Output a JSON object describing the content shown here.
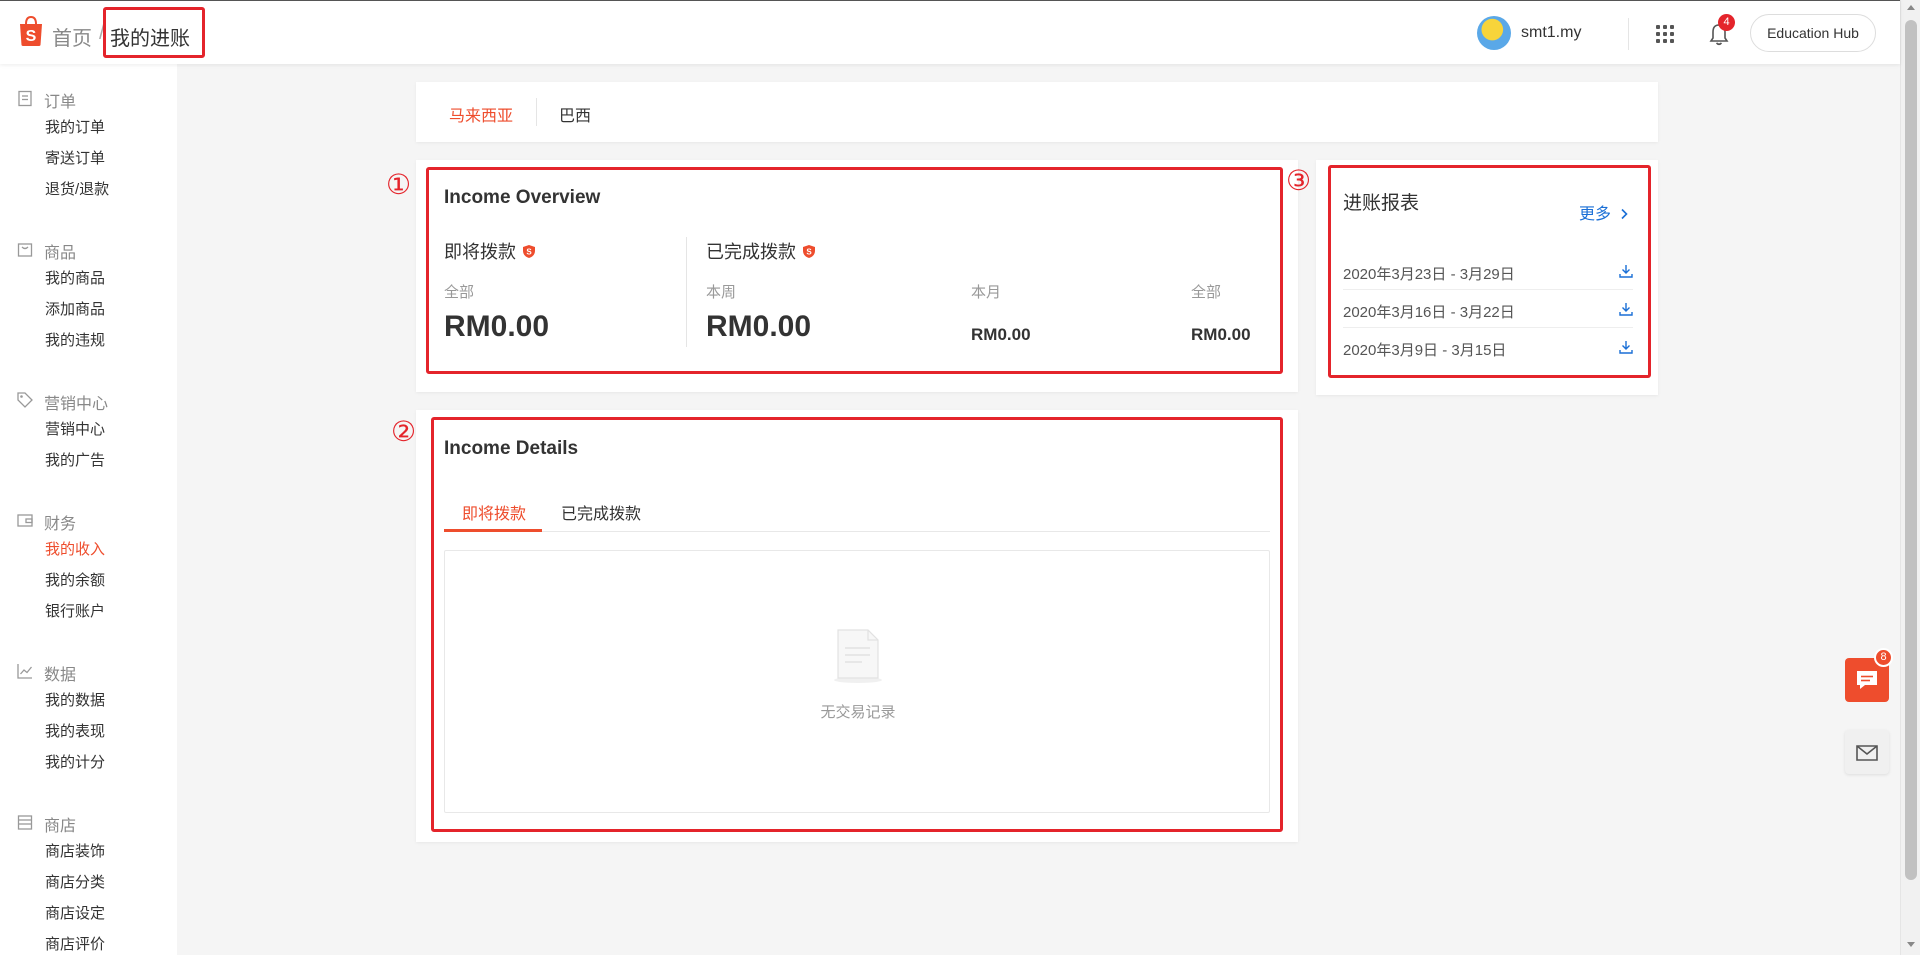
{
  "header": {
    "breadcrumb_home": "首页",
    "breadcrumb_sep": "/",
    "breadcrumb_current": "我的进账",
    "username": "smt1.my",
    "notification_count": "4",
    "education_hub": "Education Hub"
  },
  "sidebar": {
    "sections": [
      {
        "title": "订单",
        "icon": "clipboard-icon",
        "items": [
          "我的订单",
          "寄送订单",
          "退货/退款"
        ]
      },
      {
        "title": "商品",
        "icon": "bag-icon",
        "items": [
          "我的商品",
          "添加商品",
          "我的违规"
        ]
      },
      {
        "title": "营销中心",
        "icon": "tag-icon",
        "items": [
          "营销中心",
          "我的广告"
        ]
      },
      {
        "title": "财务",
        "icon": "wallet-icon",
        "items": [
          "我的收入",
          "我的余额",
          "银行账户"
        ]
      },
      {
        "title": "数据",
        "icon": "chart-icon",
        "items": [
          "我的数据",
          "我的表现",
          "我的计分"
        ]
      },
      {
        "title": "商店",
        "icon": "shop-icon",
        "items": [
          "商店装饰",
          "商店分类",
          "商店设定",
          "商店评价"
        ]
      }
    ],
    "active_item": "我的收入"
  },
  "region_tabs": [
    "马来西亚",
    "巴西"
  ],
  "overview": {
    "title": "Income Overview",
    "pending_title": "即将拨款",
    "completed_title": "已完成拨款",
    "pending_label": "全部",
    "pending_value": "RM0.00",
    "week_label": "本周",
    "week_value": "RM0.00",
    "month_label": "本月",
    "month_value": "RM0.00",
    "all_label": "全部",
    "all_value": "RM0.00"
  },
  "reports": {
    "title": "进账报表",
    "more": "更多",
    "rows": [
      "2020年3月23日 - 3月29日",
      "2020年3月16日 - 3月22日",
      "2020年3月9日 - 3月15日"
    ]
  },
  "details": {
    "title": "Income Details",
    "tab_pending": "即将拨款",
    "tab_completed": "已完成拨款",
    "empty_text": "无交易记录"
  },
  "annotations": [
    "①",
    "②",
    "③"
  ],
  "chat_badge": "8",
  "colors": {
    "brand": "#ee4d2d",
    "annotation_red": "#e4242b",
    "link_blue": "#1a6fd6"
  }
}
